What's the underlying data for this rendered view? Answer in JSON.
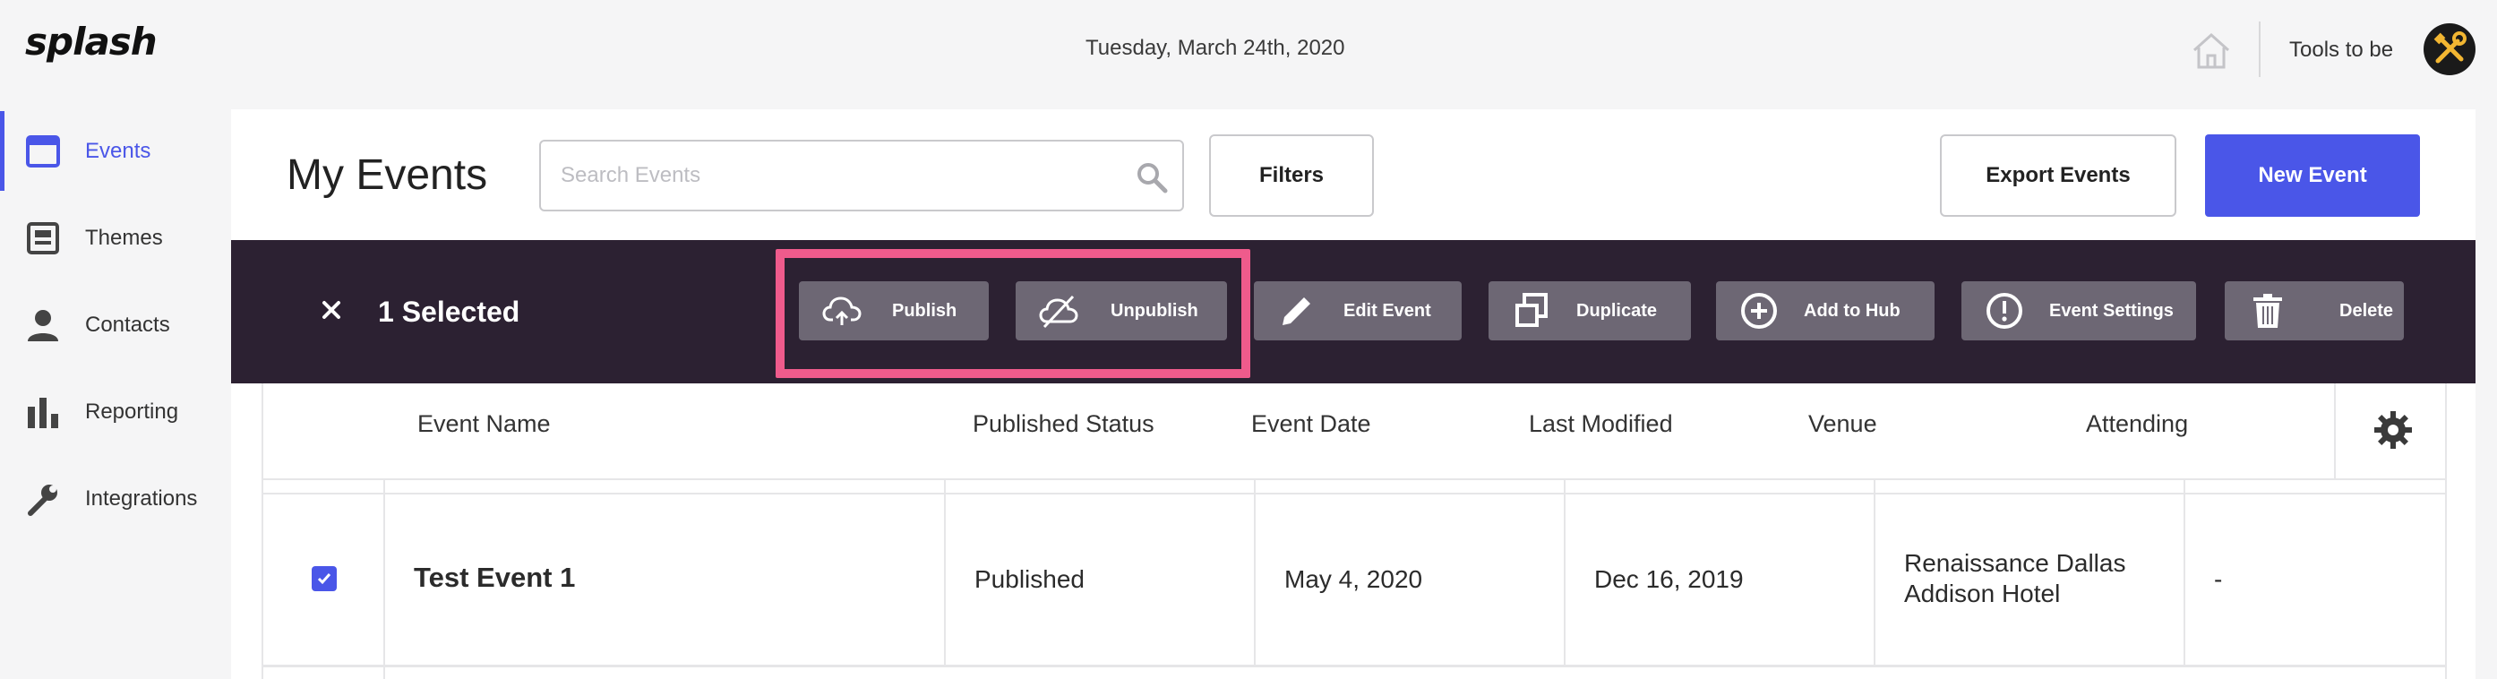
{
  "app": {
    "logo": "splash"
  },
  "header": {
    "date": "Tuesday, March 24th, 2020",
    "user_name": "Tools to be"
  },
  "sidebar": {
    "items": [
      {
        "label": "Events",
        "icon": "calendar-icon",
        "active": true
      },
      {
        "label": "Themes",
        "icon": "themes-icon",
        "active": false
      },
      {
        "label": "Contacts",
        "icon": "person-icon",
        "active": false
      },
      {
        "label": "Reporting",
        "icon": "bar-chart-icon",
        "active": false
      },
      {
        "label": "Integrations",
        "icon": "wrench-icon",
        "active": false
      }
    ]
  },
  "main": {
    "title": "My Events",
    "search_placeholder": "Search Events",
    "filters_label": "Filters",
    "export_label": "Export Events",
    "new_event_label": "New Event"
  },
  "selection": {
    "count_label": "1 Selected",
    "actions": [
      {
        "label": "Publish",
        "icon": "cloud-upload-icon"
      },
      {
        "label": "Unpublish",
        "icon": "cloud-off-icon"
      },
      {
        "label": "Edit Event",
        "icon": "pencil-icon"
      },
      {
        "label": "Duplicate",
        "icon": "duplicate-icon"
      },
      {
        "label": "Add to Hub",
        "icon": "plus-circle-icon"
      },
      {
        "label": "Event Settings",
        "icon": "alert-circle-icon"
      },
      {
        "label": "Delete",
        "icon": "trash-icon"
      }
    ]
  },
  "table": {
    "columns": [
      "Event Name",
      "Published Status",
      "Event Date",
      "Last Modified",
      "Venue",
      "Attending"
    ],
    "rows": [
      {
        "selected": true,
        "event_name": "Test Event 1",
        "published_status": "Published",
        "event_date": "May 4, 2020",
        "last_modified": "Dec 16, 2019",
        "venue_line1": "Renaissance Dallas",
        "venue_line2": "Addison Hotel",
        "attending": "-"
      }
    ]
  },
  "colors": {
    "accent": "#4a56e8",
    "selection_bar": "#2c2132",
    "action_button": "#6d6774",
    "highlight": "#ef5b8c"
  }
}
